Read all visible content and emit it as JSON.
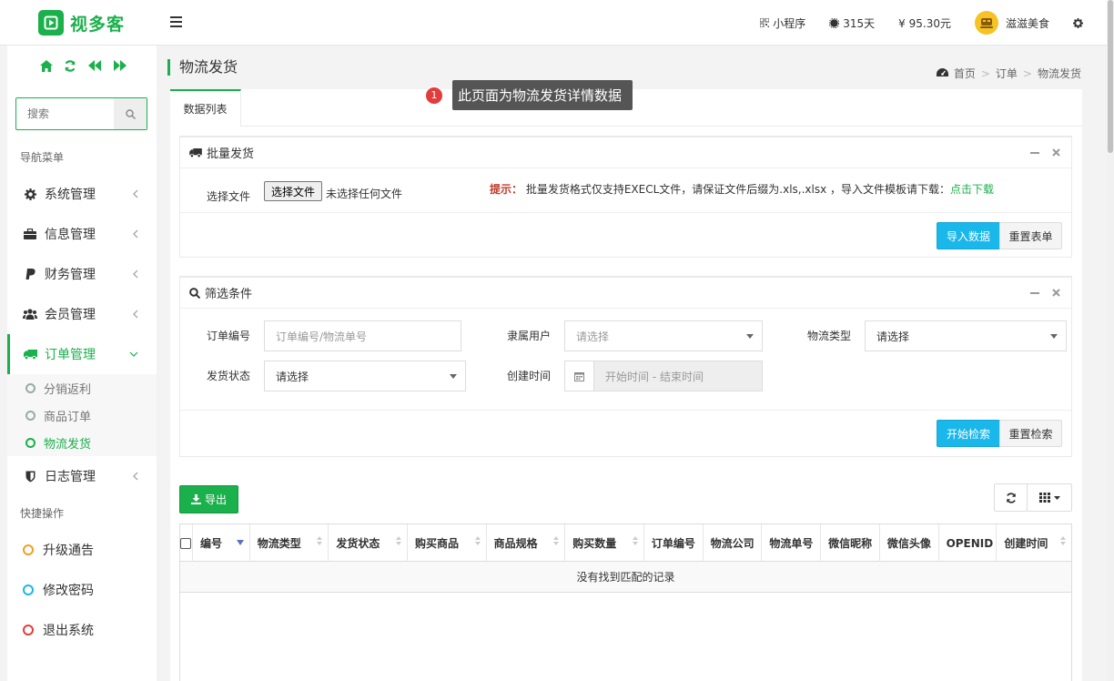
{
  "app": {
    "logo_text": "视多客"
  },
  "topbar": {
    "mini_program": "小程序",
    "days": "315天",
    "balance": "¥ 95.30元",
    "user_name": "滋滋美食"
  },
  "sidebar": {
    "search_placeholder": "搜索",
    "nav_section": "导航菜单",
    "items": [
      {
        "label": "系统管理"
      },
      {
        "label": "信息管理"
      },
      {
        "label": "财务管理"
      },
      {
        "label": "会员管理"
      },
      {
        "label": "订单管理"
      },
      {
        "label": "日志管理"
      }
    ],
    "sub_items": [
      {
        "label": "分销返利"
      },
      {
        "label": "商品订单"
      },
      {
        "label": "物流发货"
      }
    ],
    "quick_section": "快捷操作",
    "quick_items": [
      {
        "label": "升级通告",
        "color": "#f0a020"
      },
      {
        "label": "修改密码",
        "color": "#1ab7ea"
      },
      {
        "label": "退出系统",
        "color": "#e23d3d"
      }
    ]
  },
  "page": {
    "title": "物流发货",
    "breadcrumb": [
      "首页",
      "订单",
      "物流发货"
    ],
    "tooltip_badge": "1",
    "tooltip_text": "此页面为物流发货详情数据",
    "tab_label": "数据列表"
  },
  "batch": {
    "title": "批量发货",
    "file_label": "选择文件",
    "file_button": "选择文件",
    "file_status": "未选择任何文件",
    "hint_prefix": "提示：",
    "hint_text": "批量发货格式仅支持EXECL文件，请保证文件后缀为.xls,.xlsx ，导入文件模板请下载：",
    "hint_link": "点击下载",
    "import_button": "导入数据",
    "reset_button": "重置表单"
  },
  "filter": {
    "title": "筛选条件",
    "order_no_label": "订单编号",
    "order_no_placeholder": "订单编号/物流单号",
    "user_label": "隶属用户",
    "user_placeholder": "请选择",
    "logistics_type_label": "物流类型",
    "logistics_type_value": "请选择",
    "ship_status_label": "发货状态",
    "ship_status_value": "请选择",
    "created_label": "创建时间",
    "created_placeholder": "开始时间 - 结束时间",
    "search_button": "开始检索",
    "reset_button": "重置检索"
  },
  "table": {
    "export_button": "导出",
    "columns": [
      "编号",
      "物流类型",
      "发货状态",
      "购买商品",
      "商品规格",
      "购买数量",
      "订单编号",
      "物流公司",
      "物流单号",
      "微信昵称",
      "微信头像",
      "OPENID",
      "创建时间"
    ],
    "empty_text": "没有找到匹配的记录"
  },
  "colors": {
    "brand": "#1ab04b",
    "primary": "#1ab7ea"
  }
}
